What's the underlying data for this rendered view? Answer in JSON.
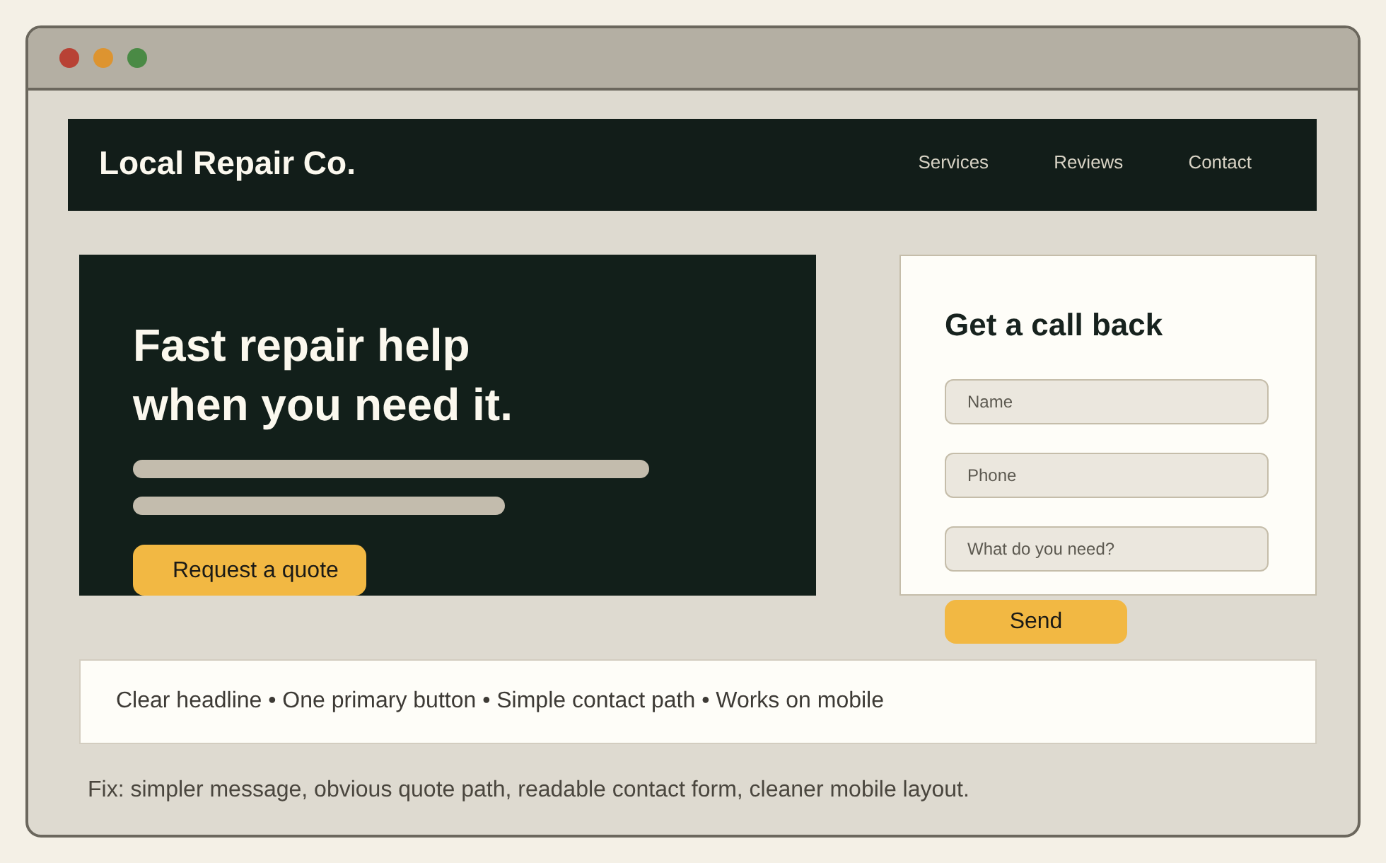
{
  "nav": {
    "logo": "Local Repair Co.",
    "links": [
      "Services",
      "Reviews",
      "Contact"
    ]
  },
  "hero": {
    "headline": "Fast repair help when you need it.",
    "button": "Request a quote"
  },
  "form": {
    "title": "Get a call back",
    "fields": [
      {
        "placeholder": "Name"
      },
      {
        "placeholder": "Phone"
      },
      {
        "placeholder": "What do you need?"
      }
    ],
    "button": "Send"
  },
  "highlights": "Clear headline • One primary button • Simple contact path • Works on mobile",
  "note": "Fix: simpler message, obvious quote path, readable contact form, cleaner mobile layout."
}
